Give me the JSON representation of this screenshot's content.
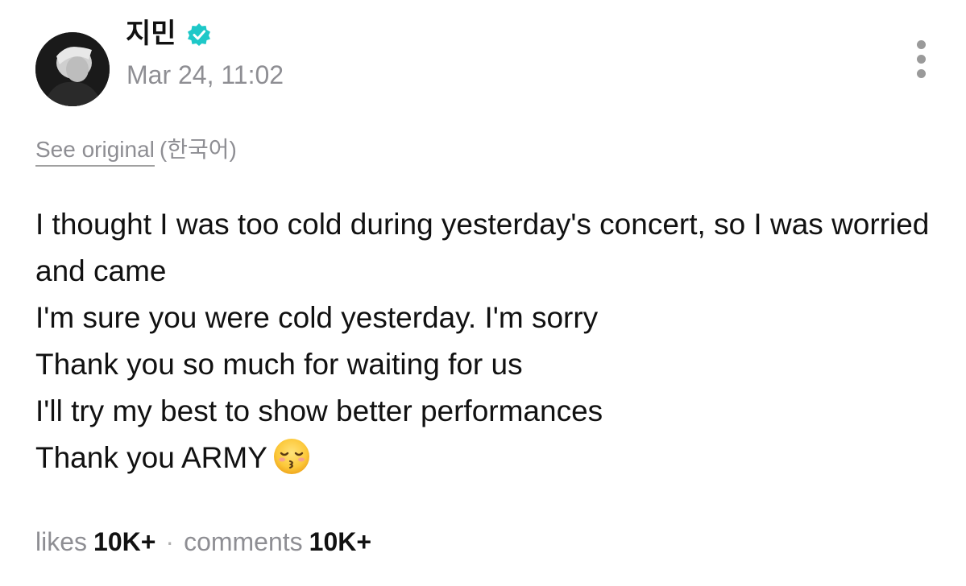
{
  "post": {
    "author": {
      "name": "지민",
      "verified": true,
      "verified_color": "#1ec8c8",
      "avatar_icon": "profile-photo"
    },
    "timestamp": "Mar 24, 11:02",
    "menu_icon": "more-vertical-icon",
    "translation": {
      "see_original_label": "See original",
      "language": "(한국어)"
    },
    "body_lines": [
      "I thought I was too cold during yesterday's concert, so I was worried and came",
      "I'm sure you were cold yesterday. I'm sorry",
      "Thank you so much for waiting for us",
      "I'll try my best to show better performances",
      "Thank you ARMY"
    ],
    "emoji": "kissing-face-with-closed-eyes",
    "stats": {
      "likes_label": "likes",
      "likes_count": "10K+",
      "separator": "·",
      "comments_label": "comments",
      "comments_count": "10K+"
    }
  }
}
